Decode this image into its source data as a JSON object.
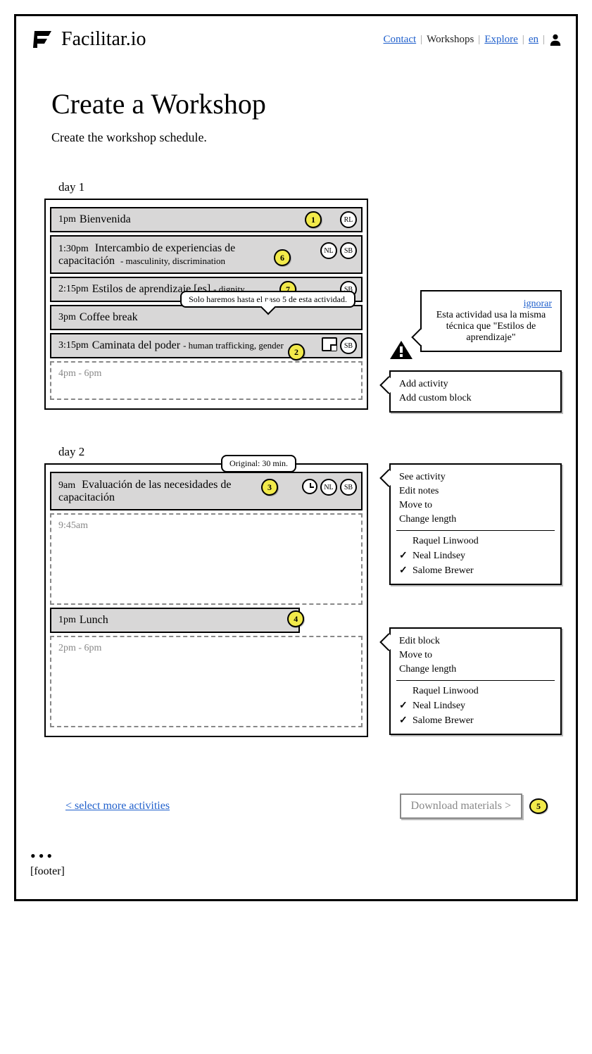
{
  "brand": "Facilitar.io",
  "nav": {
    "contact": "Contact",
    "workshops": "Workshops",
    "explore": "Explore",
    "lang": "en"
  },
  "page": {
    "title": "Create a Workshop",
    "subtitle": "Create the workshop schedule."
  },
  "day1": {
    "label": "day 1",
    "blocks": [
      {
        "time": "1pm",
        "title": "Bienvenida",
        "marker": "1",
        "chips": [
          "RL"
        ]
      },
      {
        "time": "1:30pm",
        "title": "Intercambio de experiencias de capacitación",
        "tags": " - masculinity, discrimination",
        "marker": "6",
        "chips": [
          "NL",
          "SB"
        ]
      },
      {
        "time": "2:15pm",
        "title": "Estilos de aprendizaje [es]",
        "tags": " - dignity",
        "marker": "7",
        "chips": [
          "SB"
        ]
      },
      {
        "time": "3pm",
        "title": "Coffee break",
        "tooltip": "Solo haremos hasta el paso 5 de esta actividad."
      },
      {
        "time": "3:15pm",
        "title": "Caminata del poder",
        "tags": " - human trafficking, gender",
        "marker": "2",
        "chips": [
          "SB"
        ],
        "note": true
      }
    ],
    "drop": "4pm - 6pm"
  },
  "warning": {
    "ignore": "ignorar",
    "text": "Esta actividad usa la misma técnica que \"Estilos de aprendizaje\""
  },
  "addMenu": {
    "activity": "Add activity",
    "custom": "Add custom block"
  },
  "day2": {
    "label": "day 2",
    "tooltip": "Original: 30 min.",
    "block1": {
      "time": "9am",
      "title": "Evaluación de las necesidades de capacitación",
      "marker": "3",
      "chips": [
        "NL",
        "SB"
      ],
      "history": true
    },
    "drop1": "9:45am",
    "block2": {
      "time": "1pm",
      "title": "Lunch",
      "marker": "4"
    },
    "drop2": "2pm - 6pm"
  },
  "activityMenu": {
    "items": [
      "See activity",
      "Edit notes",
      "Move to",
      "Change length"
    ],
    "people": [
      {
        "name": "Raquel Linwood",
        "checked": false
      },
      {
        "name": "Neal Lindsey",
        "checked": true
      },
      {
        "name": "Salome Brewer",
        "checked": true
      }
    ]
  },
  "blockMenu": {
    "items": [
      "Edit block",
      "Move to",
      "Change length"
    ],
    "people": [
      {
        "name": "Raquel Linwood",
        "checked": false
      },
      {
        "name": "Neal Lindsey",
        "checked": true
      },
      {
        "name": "Salome Brewer",
        "checked": true
      }
    ]
  },
  "actions": {
    "back": "< select more activities",
    "download": "Download materials >",
    "marker": "5"
  },
  "footer": "[footer]"
}
